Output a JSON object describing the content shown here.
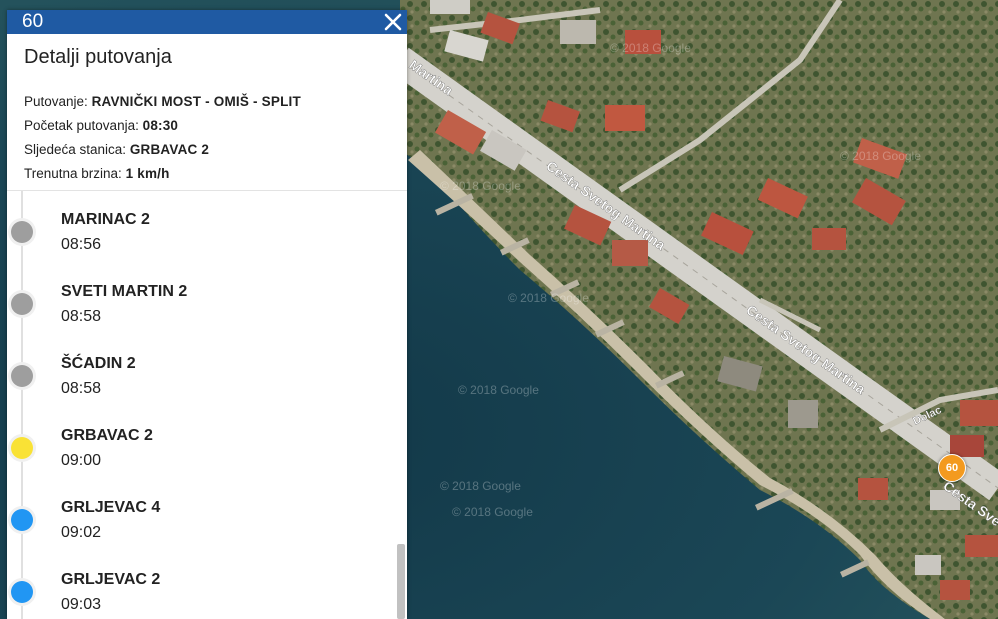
{
  "header": {
    "route_number": "60",
    "close_icon": "close-icon"
  },
  "details": {
    "title": "Detalji putovanja",
    "trip_label": "Putovanje:",
    "trip_value": "RAVNIČKI MOST - OMIŠ - SPLIT",
    "start_label": "Početak putovanja:",
    "start_value": "08:30",
    "next_stop_label": "Sljedeća stanica:",
    "next_stop_value": "GRBAVAC 2",
    "speed_label": "Trenutna brzina:",
    "speed_value": "1 km/h"
  },
  "stops": [
    {
      "name": "MARINAC 2",
      "time": "08:56",
      "status": "passed"
    },
    {
      "name": "SVETI MARTIN 2",
      "time": "08:58",
      "status": "passed"
    },
    {
      "name": "ŠĆADIN 2",
      "time": "08:58",
      "status": "passed"
    },
    {
      "name": "GRBAVAC 2",
      "time": "09:00",
      "status": "next"
    },
    {
      "name": "GRLJEVAC 4",
      "time": "09:02",
      "status": "upcoming"
    },
    {
      "name": "GRLJEVAC 2",
      "time": "09:03",
      "status": "upcoming"
    }
  ],
  "status_colors": {
    "passed": "#9e9e9e",
    "next": "#f9e235",
    "upcoming": "#2196f3"
  },
  "map": {
    "road_labels": [
      "Cesta Svetog Martina",
      "Cesta Svetog Martina",
      "Martina",
      "Cesta Sve",
      "Dolac"
    ],
    "watermarks": [
      "© 2018 Google",
      "© 2018 Google",
      "© 2018 Google",
      "© 2018 Google",
      "© 2018 Google",
      "© 2018 Google",
      "© 2018 Google"
    ],
    "bus_marker_label": "60",
    "bus_marker_color": "#f39a1f"
  }
}
